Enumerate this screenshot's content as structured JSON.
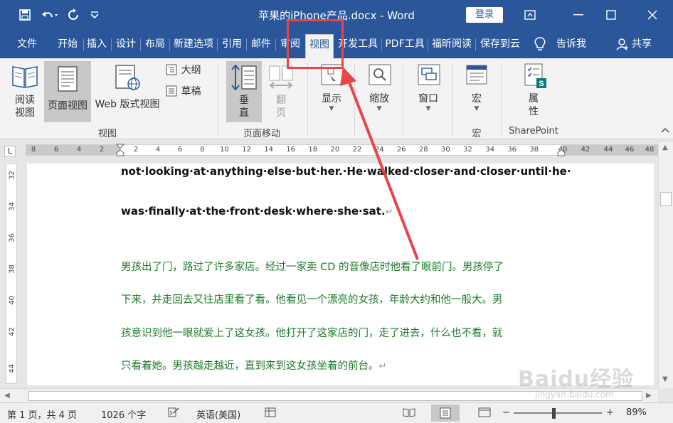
{
  "titlebar": {
    "title": "苹果的iPhone产品.docx - Word",
    "login_label": "登录",
    "qat_icons": [
      "save-icon",
      "undo-icon",
      "redo-icon",
      "customize-qat-icon"
    ],
    "window_controls": [
      "ribbon-display-icon",
      "minimize-icon",
      "maximize-icon",
      "close-icon"
    ]
  },
  "tabs": [
    {
      "label": "文件"
    },
    {
      "label": "开始"
    },
    {
      "label": "插入"
    },
    {
      "label": "设计"
    },
    {
      "label": "布局"
    },
    {
      "label": "新建选项"
    },
    {
      "label": "引用"
    },
    {
      "label": "邮件"
    },
    {
      "label": "审阅"
    },
    {
      "label": "视图",
      "active": true
    },
    {
      "label": "开发工具"
    },
    {
      "label": "PDF工具"
    },
    {
      "label": "福昕阅读"
    },
    {
      "label": "保存到云"
    }
  ],
  "tellme_label": "告诉我",
  "share_label": "共享",
  "ribbon": {
    "read_mode": "阅读\n视图",
    "print_layout": "页面视图",
    "web_layout": "Web 版式视图",
    "outline": "大纲",
    "draft": "草稿",
    "views_group": "视图",
    "vertical": "垂\n直",
    "side_to_side": "翻\n页",
    "page_move_group": "页面移动",
    "show": "显示",
    "zoom": "缩放",
    "window": "窗口",
    "macros": "宏",
    "macros_group": "宏",
    "properties": "属\n性",
    "sharepoint_group": "SharePoint"
  },
  "ruler": {
    "corner": "L",
    "left_numbers": [
      "8",
      "6",
      "4",
      "2"
    ],
    "numbers": [
      "2",
      "4",
      "6",
      "8",
      "10",
      "12",
      "14",
      "16",
      "18",
      "20",
      "22",
      "24",
      "26",
      "28",
      "30",
      "32",
      "34",
      "36",
      "38"
    ],
    "right_numbers": [
      "40",
      "42",
      "44",
      "46",
      "48"
    ],
    "vertical_numbers": [
      "32",
      "34",
      "36",
      "38",
      "40",
      "42",
      "44"
    ]
  },
  "document": {
    "english_lines": [
      "not·looking·at·anything·else·but·her.·He·walked·closer·and·closer·until·he·",
      "was·finally·at·the·front·desk·where·she·sat."
    ],
    "chinese_lines": [
      "男孩出了门，路过了许多家店。经过一家卖 CD 的音像店时他看了眼前门。男孩停了",
      "下来，并走回去又往店里看了看。他看见一个漂亮的女孩，年龄大约和他一般大。男",
      "孩意识到他一眼就爱上了这女孩。他打开了这家店的门，走了进去，什么也不看，就",
      "只看着她。男孩越走越近，直到来到这女孩坐着的前台。"
    ],
    "paragraph_mark": "↵"
  },
  "status": {
    "page": "第 1 页，共 4 页",
    "words": "1026 个字",
    "language": "英语(美国)",
    "zoom_percent": "89%",
    "zoom_minus": "−",
    "zoom_plus": "+"
  },
  "watermark": {
    "text": "Baidu经验",
    "url": "jingyan.baidu.com"
  },
  "colors": {
    "titlebar": "#2b579a",
    "chinese_text": "#1e7b2c",
    "annotation": "#e8444a"
  }
}
